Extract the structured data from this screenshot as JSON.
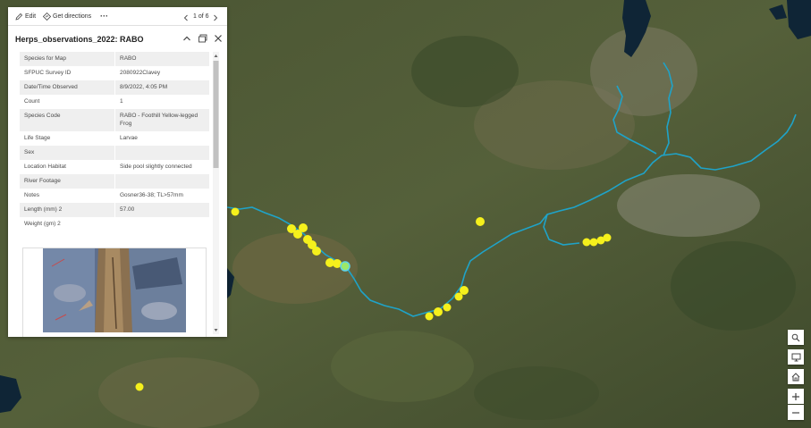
{
  "toolbar": {
    "edit_label": "Edit",
    "directions_label": "Get directions",
    "more_label": "···",
    "pager_text": "1 of 6"
  },
  "popup": {
    "title": "Herps_observations_2022: RABO",
    "fields": [
      {
        "key": "Species for Map",
        "value": "RABO"
      },
      {
        "key": "SFPUC Survey ID",
        "value": "2080922Clavey"
      },
      {
        "key": "Date/Time Observed",
        "value": "8/9/2022, 4:05 PM"
      },
      {
        "key": "Count",
        "value": "1"
      },
      {
        "key": "Species Code",
        "value": "RABO - Foothill Yellow-legged Frog"
      },
      {
        "key": "Life Stage",
        "value": "Larvae"
      },
      {
        "key": "Sex",
        "value": ""
      },
      {
        "key": "Location Habitat",
        "value": "Side pool slightly connected"
      },
      {
        "key": "River Footage",
        "value": ""
      },
      {
        "key": "Notes",
        "value": "Gosner36-38; TL>57mm"
      },
      {
        "key": "Length (mm) 2",
        "value": "57.00"
      },
      {
        "key": "Weight (gm) 2",
        "value": ""
      }
    ]
  },
  "icons": {
    "edit": "pencil-icon",
    "directions": "directions-icon",
    "prev": "chevron-left-icon",
    "next": "chevron-right-icon",
    "collapse": "chevron-up-icon",
    "dock": "dock-icon",
    "close": "close-icon",
    "search": "search-icon",
    "basemap": "monitor-icon",
    "home": "home-icon",
    "zoom_in": "plus-icon",
    "zoom_out": "minus-icon"
  },
  "colors": {
    "river": "#1fa3c8",
    "observation_point": "#f5f01c",
    "selected_point": "#9be86a",
    "terrain": "#4a5a34"
  }
}
